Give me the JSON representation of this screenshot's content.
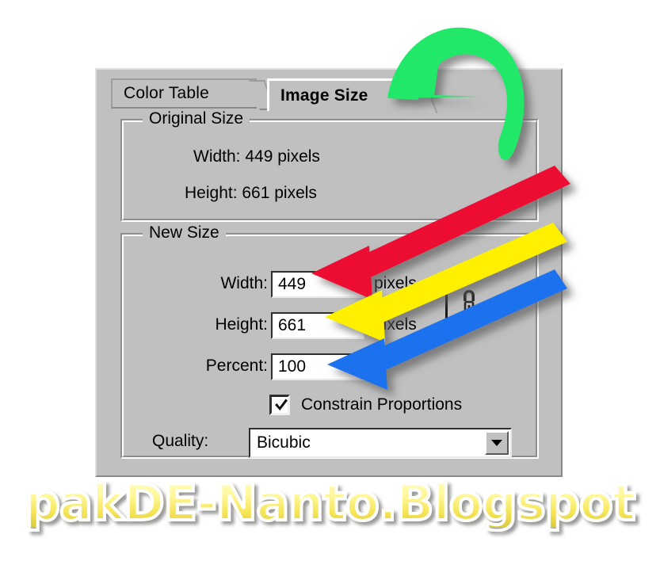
{
  "dialog": {
    "tabs": [
      {
        "id": "color-table",
        "label": "Color Table",
        "active": false
      },
      {
        "id": "image-size",
        "label": "Image Size",
        "active": true
      }
    ],
    "original_size": {
      "legend": "Original Size",
      "width_text": "Width: 449 pixels",
      "height_text": "Height: 661 pixels"
    },
    "new_size": {
      "legend": "New Size",
      "width_label": "Width:",
      "width_value": "449",
      "width_unit": "pixels",
      "height_label": "Height:",
      "height_value": "661",
      "height_unit": "pixels",
      "percent_label": "Percent:",
      "percent_value": "100",
      "constrain_label": "Constrain Proportions",
      "constrain_checked": true,
      "quality_label": "Quality:",
      "quality_value": "Bicubic"
    }
  },
  "annotations": {
    "green_arrow": {
      "name": "green-curved-arrow",
      "color": "#22E86B",
      "points_to": "Image Size"
    },
    "red_arrow": {
      "name": "red-arrow",
      "color": "#ED1133",
      "points_to": "Width field"
    },
    "yellow_arrow": {
      "name": "yellow-arrow",
      "color": "#FFF000",
      "points_to": "Height field"
    },
    "blue_arrow": {
      "name": "blue-arrow",
      "color": "#1E72EE",
      "points_to": "Percent field"
    }
  },
  "watermark": {
    "text": "pakDE-Nanto.Blogspot",
    "fill_top": "#FFFDC2",
    "fill_bottom": "#D9C93C",
    "outline": "#FFFFFF"
  },
  "icons": {
    "chain_link": "chain-link-icon",
    "checkmark": "checkmark-icon",
    "dropdown_arrow": "chevron-down-icon"
  }
}
